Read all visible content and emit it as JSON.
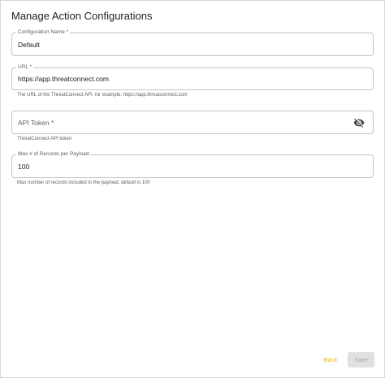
{
  "dialog": {
    "title": "Manage Action Configurations"
  },
  "fields": {
    "config_name": {
      "label": "Configuration Name *",
      "value": "Default"
    },
    "url": {
      "label": "URL *",
      "value": "https://app.threatconnect.com",
      "helper": "The URL of the ThreatConnect API, for example, https://app.threatconnect.com"
    },
    "api_token": {
      "placeholder": "API Token *",
      "helper": "ThreatConnect API token",
      "icon": "visibility-off-icon"
    },
    "max_records": {
      "label": "Max # of Records per Payload",
      "value": "100",
      "helper": "Max number of records included in the payload, default is 100"
    }
  },
  "actions": {
    "back_label": "Back",
    "save_label": "Save"
  },
  "colors": {
    "accent": "#f5b800",
    "disabled_bg": "#e0e0e0",
    "disabled_text": "#a8a8a8"
  }
}
